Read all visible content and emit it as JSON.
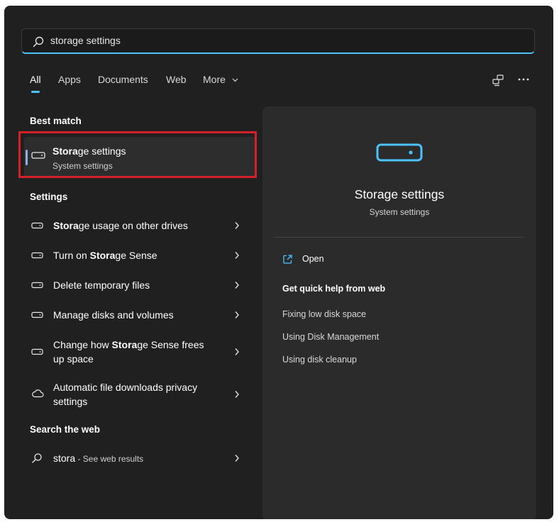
{
  "search": {
    "value": "storage settings",
    "placeholder": "Type here to search"
  },
  "tabs": [
    {
      "label": "All",
      "active": true
    },
    {
      "label": "Apps"
    },
    {
      "label": "Documents"
    },
    {
      "label": "Web"
    },
    {
      "label": "More"
    }
  ],
  "top_right": {
    "icons": [
      "share-devices-icon",
      "more-options-icon"
    ]
  },
  "best_match": {
    "heading": "Best match",
    "item": {
      "title_bold": "Stora",
      "title_rest": "ge settings",
      "subtitle": "System settings",
      "icon": "storage-drive-icon"
    }
  },
  "settings": {
    "heading": "Settings",
    "items": [
      {
        "pre": "",
        "bold": "Stora",
        "post": "ge usage on other drives",
        "icon": "storage-drive-icon"
      },
      {
        "pre": "Turn on ",
        "bold": "Stora",
        "post": "ge Sense",
        "icon": "storage-drive-icon"
      },
      {
        "pre": "Delete temporary files",
        "bold": "",
        "post": "",
        "icon": "storage-drive-icon"
      },
      {
        "pre": "Manage disks and volumes",
        "bold": "",
        "post": "",
        "icon": "storage-drive-icon"
      },
      {
        "pre": "Change how ",
        "bold": "Stora",
        "post": "ge Sense frees up space",
        "icon": "storage-drive-icon"
      },
      {
        "pre": "Automatic file downloads privacy settings",
        "bold": "",
        "post": "",
        "icon": "cloud-icon"
      }
    ]
  },
  "web": {
    "heading": "Search the web",
    "query": "stora",
    "suffix": " - See web results",
    "icon": "search-icon"
  },
  "preview": {
    "title": "Storage settings",
    "subtitle": "System settings",
    "open_label": "Open",
    "help_heading": "Get quick help from web",
    "help_links": [
      "Fixing low disk space",
      "Using Disk Management",
      "Using disk cleanup"
    ]
  },
  "colors": {
    "accent": "#4cc2ff",
    "highlight": "#d4202a",
    "background": "#202020",
    "panel": "#2b2b2b"
  }
}
